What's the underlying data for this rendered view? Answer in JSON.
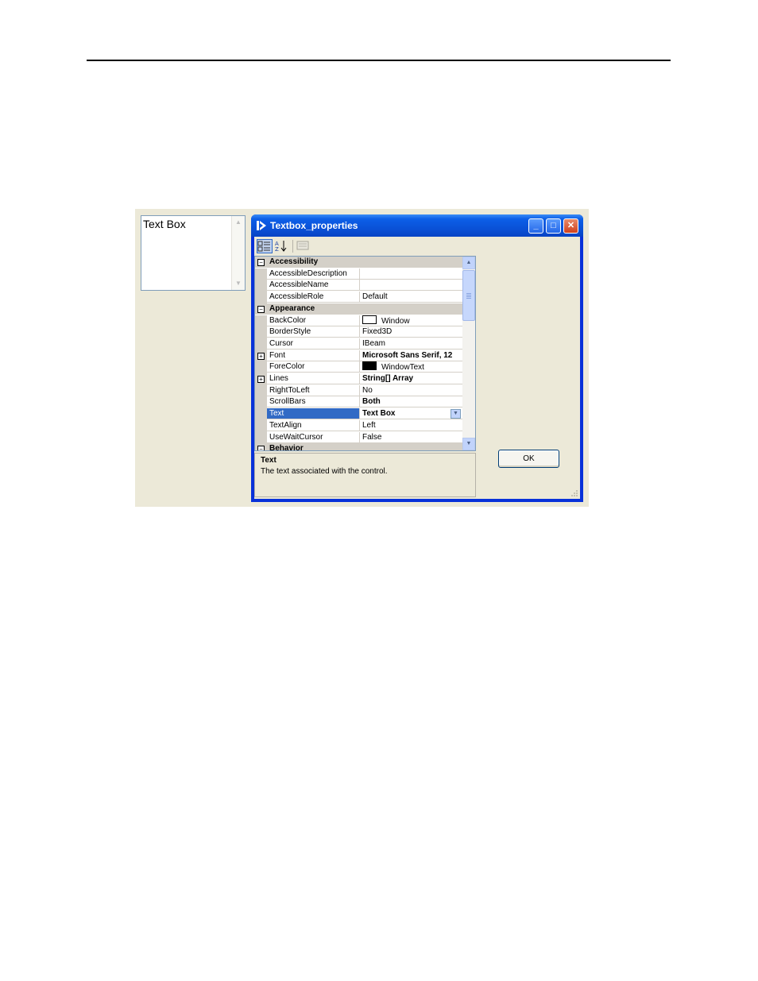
{
  "textbox": {
    "text": "Text Box"
  },
  "window": {
    "title": "Textbox_properties",
    "minimize": "_",
    "maximize": "□",
    "close": "✕"
  },
  "grid": {
    "rows": [
      {
        "type": "category",
        "label": "Accessibility",
        "expander": "−"
      },
      {
        "type": "prop",
        "name": "AccessibleDescription",
        "value": ""
      },
      {
        "type": "prop",
        "name": "AccessibleName",
        "value": ""
      },
      {
        "type": "prop",
        "name": "AccessibleRole",
        "value": "Default"
      },
      {
        "type": "category",
        "label": "Appearance",
        "expander": "−"
      },
      {
        "type": "prop",
        "name": "BackColor",
        "value": "Window",
        "swatch": "#ffffff"
      },
      {
        "type": "prop",
        "name": "BorderStyle",
        "value": "Fixed3D"
      },
      {
        "type": "prop",
        "name": "Cursor",
        "value": "IBeam"
      },
      {
        "type": "prop",
        "name": "Font",
        "value": "Microsoft Sans Serif, 12",
        "bold": true,
        "expander": "+"
      },
      {
        "type": "prop",
        "name": "ForeColor",
        "value": "WindowText",
        "swatch": "#000000"
      },
      {
        "type": "prop",
        "name": "Lines",
        "value": "String[] Array",
        "bold": true,
        "expander": "+"
      },
      {
        "type": "prop",
        "name": "RightToLeft",
        "value": "No"
      },
      {
        "type": "prop",
        "name": "ScrollBars",
        "value": "Both",
        "bold": true
      },
      {
        "type": "prop",
        "name": "Text",
        "value": "Text Box",
        "bold": true,
        "selected": true
      },
      {
        "type": "prop",
        "name": "TextAlign",
        "value": "Left"
      },
      {
        "type": "prop",
        "name": "UseWaitCursor",
        "value": "False"
      },
      {
        "type": "category",
        "label": "Behavior",
        "expander": "−"
      }
    ]
  },
  "description": {
    "title": "Text",
    "text": "The text associated with the control."
  },
  "ok_label": "OK",
  "colors": {
    "title_bar": "#0a4fd4",
    "selection": "#316ac5",
    "dialog_bg": "#ece9d8"
  }
}
